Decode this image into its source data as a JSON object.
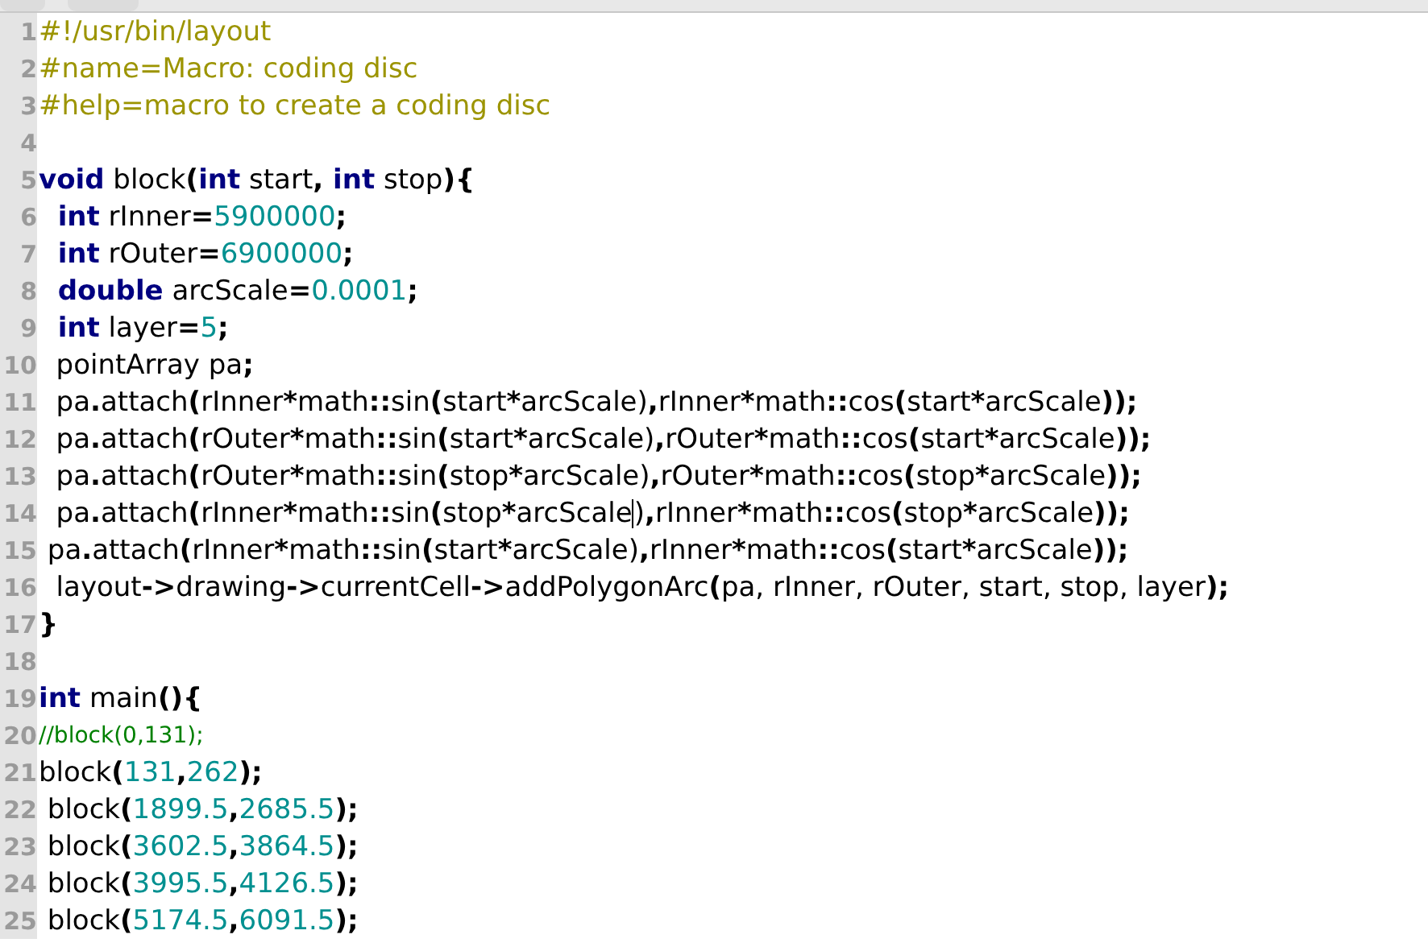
{
  "editor": {
    "lines": [
      {
        "number": "1",
        "tokens": [
          {
            "kind": "meta",
            "text": "#!/usr/bin/layout"
          }
        ]
      },
      {
        "number": "2",
        "tokens": [
          {
            "kind": "meta",
            "text": "#name=Macro: coding disc"
          }
        ]
      },
      {
        "number": "3",
        "tokens": [
          {
            "kind": "meta",
            "text": "#help=macro to create a coding disc"
          }
        ]
      },
      {
        "number": "4"
      },
      {
        "number": "5",
        "tokens": [
          {
            "kind": "kw",
            "text": "void"
          },
          {
            "kind": "id",
            "text": " block"
          },
          {
            "kind": "op",
            "text": "("
          },
          {
            "kind": "kw",
            "text": "int"
          },
          {
            "kind": "id",
            "text": " start"
          },
          {
            "kind": "op",
            "text": ","
          },
          {
            "kind": "kw",
            "text": " int"
          },
          {
            "kind": "id",
            "text": " stop"
          },
          {
            "kind": "op",
            "text": "){"
          }
        ]
      },
      {
        "number": "6",
        "tokens": [
          {
            "kind": "kw",
            "text": "  int"
          },
          {
            "kind": "id",
            "text": " rInner"
          },
          {
            "kind": "op",
            "text": "="
          },
          {
            "kind": "num",
            "text": "5900000"
          },
          {
            "kind": "op",
            "text": ";"
          }
        ]
      },
      {
        "number": "7",
        "tokens": [
          {
            "kind": "kw",
            "text": "  int"
          },
          {
            "kind": "id",
            "text": " rOuter"
          },
          {
            "kind": "op",
            "text": "="
          },
          {
            "kind": "num",
            "text": "6900000"
          },
          {
            "kind": "op",
            "text": ";"
          }
        ]
      },
      {
        "number": "8",
        "tokens": [
          {
            "kind": "kw",
            "text": "  double"
          },
          {
            "kind": "id",
            "text": " arcScale"
          },
          {
            "kind": "op",
            "text": "="
          },
          {
            "kind": "num",
            "text": "0.0001"
          },
          {
            "kind": "op",
            "text": ";"
          }
        ]
      },
      {
        "number": "9",
        "tokens": [
          {
            "kind": "kw",
            "text": "  int"
          },
          {
            "kind": "id",
            "text": " layer"
          },
          {
            "kind": "op",
            "text": "="
          },
          {
            "kind": "num",
            "text": "5"
          },
          {
            "kind": "op",
            "text": ";"
          }
        ]
      },
      {
        "number": "10",
        "tokens": [
          {
            "kind": "id",
            "text": "  pointArray pa"
          },
          {
            "kind": "op",
            "text": ";"
          }
        ]
      },
      {
        "number": "11",
        "tokens": [
          {
            "kind": "id",
            "text": "  pa"
          },
          {
            "kind": "op",
            "text": "."
          },
          {
            "kind": "id",
            "text": "attach"
          },
          {
            "kind": "op",
            "text": "("
          },
          {
            "kind": "id",
            "text": "rInner"
          },
          {
            "kind": "op",
            "text": "*"
          },
          {
            "kind": "id",
            "text": "math"
          },
          {
            "kind": "op",
            "text": "::"
          },
          {
            "kind": "id",
            "text": "sin"
          },
          {
            "kind": "op",
            "text": "("
          },
          {
            "kind": "id",
            "text": "start"
          },
          {
            "kind": "op",
            "text": "*"
          },
          {
            "kind": "id",
            "text": "arcScale)"
          },
          {
            "kind": "op",
            "text": ","
          },
          {
            "kind": "id",
            "text": "rInner"
          },
          {
            "kind": "op",
            "text": "*"
          },
          {
            "kind": "id",
            "text": "math"
          },
          {
            "kind": "op",
            "text": "::"
          },
          {
            "kind": "id",
            "text": "cos"
          },
          {
            "kind": "op",
            "text": "("
          },
          {
            "kind": "id",
            "text": "start"
          },
          {
            "kind": "op",
            "text": "*"
          },
          {
            "kind": "id",
            "text": "arcScale"
          },
          {
            "kind": "op",
            "text": "));"
          }
        ]
      },
      {
        "number": "12",
        "tokens": [
          {
            "kind": "id",
            "text": "  pa"
          },
          {
            "kind": "op",
            "text": "."
          },
          {
            "kind": "id",
            "text": "attach"
          },
          {
            "kind": "op",
            "text": "("
          },
          {
            "kind": "id",
            "text": "rOuter"
          },
          {
            "kind": "op",
            "text": "*"
          },
          {
            "kind": "id",
            "text": "math"
          },
          {
            "kind": "op",
            "text": "::"
          },
          {
            "kind": "id",
            "text": "sin"
          },
          {
            "kind": "op",
            "text": "("
          },
          {
            "kind": "id",
            "text": "start"
          },
          {
            "kind": "op",
            "text": "*"
          },
          {
            "kind": "id",
            "text": "arcScale)"
          },
          {
            "kind": "op",
            "text": ","
          },
          {
            "kind": "id",
            "text": "rOuter"
          },
          {
            "kind": "op",
            "text": "*"
          },
          {
            "kind": "id",
            "text": "math"
          },
          {
            "kind": "op",
            "text": "::"
          },
          {
            "kind": "id",
            "text": "cos"
          },
          {
            "kind": "op",
            "text": "("
          },
          {
            "kind": "id",
            "text": "start"
          },
          {
            "kind": "op",
            "text": "*"
          },
          {
            "kind": "id",
            "text": "arcScale"
          },
          {
            "kind": "op",
            "text": "));"
          }
        ]
      },
      {
        "number": "13",
        "tokens": [
          {
            "kind": "id",
            "text": "  pa"
          },
          {
            "kind": "op",
            "text": "."
          },
          {
            "kind": "id",
            "text": "attach"
          },
          {
            "kind": "op",
            "text": "("
          },
          {
            "kind": "id",
            "text": "rOuter"
          },
          {
            "kind": "op",
            "text": "*"
          },
          {
            "kind": "id",
            "text": "math"
          },
          {
            "kind": "op",
            "text": "::"
          },
          {
            "kind": "id",
            "text": "sin"
          },
          {
            "kind": "op",
            "text": "("
          },
          {
            "kind": "id",
            "text": "stop"
          },
          {
            "kind": "op",
            "text": "*"
          },
          {
            "kind": "id",
            "text": "arcScale)"
          },
          {
            "kind": "op",
            "text": ","
          },
          {
            "kind": "id",
            "text": "rOuter"
          },
          {
            "kind": "op",
            "text": "*"
          },
          {
            "kind": "id",
            "text": "math"
          },
          {
            "kind": "op",
            "text": "::"
          },
          {
            "kind": "id",
            "text": "cos"
          },
          {
            "kind": "op",
            "text": "("
          },
          {
            "kind": "id",
            "text": "stop"
          },
          {
            "kind": "op",
            "text": "*"
          },
          {
            "kind": "id",
            "text": "arcScale"
          },
          {
            "kind": "op",
            "text": "));"
          }
        ]
      },
      {
        "number": "14",
        "tokens": [
          {
            "kind": "id",
            "text": "  pa"
          },
          {
            "kind": "op",
            "text": "."
          },
          {
            "kind": "id",
            "text": "attach"
          },
          {
            "kind": "op",
            "text": "("
          },
          {
            "kind": "id",
            "text": "rInner"
          },
          {
            "kind": "op",
            "text": "*"
          },
          {
            "kind": "id",
            "text": "math"
          },
          {
            "kind": "op",
            "text": "::"
          },
          {
            "kind": "id",
            "text": "sin"
          },
          {
            "kind": "op",
            "text": "("
          },
          {
            "kind": "id",
            "text": "stop"
          },
          {
            "kind": "op",
            "text": "*"
          },
          {
            "kind": "id",
            "text": "arcScale"
          },
          {
            "kind": "cursor"
          },
          {
            "kind": "id",
            "text": ")"
          },
          {
            "kind": "op",
            "text": ","
          },
          {
            "kind": "id",
            "text": "rInner"
          },
          {
            "kind": "op",
            "text": "*"
          },
          {
            "kind": "id",
            "text": "math"
          },
          {
            "kind": "op",
            "text": "::"
          },
          {
            "kind": "id",
            "text": "cos"
          },
          {
            "kind": "op",
            "text": "("
          },
          {
            "kind": "id",
            "text": "stop"
          },
          {
            "kind": "op",
            "text": "*"
          },
          {
            "kind": "id",
            "text": "arcScale"
          },
          {
            "kind": "op",
            "text": "));"
          }
        ]
      },
      {
        "number": "15",
        "tokens": [
          {
            "kind": "id",
            "text": " pa"
          },
          {
            "kind": "op",
            "text": "."
          },
          {
            "kind": "id",
            "text": "attach"
          },
          {
            "kind": "op",
            "text": "("
          },
          {
            "kind": "id",
            "text": "rInner"
          },
          {
            "kind": "op",
            "text": "*"
          },
          {
            "kind": "id",
            "text": "math"
          },
          {
            "kind": "op",
            "text": "::"
          },
          {
            "kind": "id",
            "text": "sin"
          },
          {
            "kind": "op",
            "text": "("
          },
          {
            "kind": "id",
            "text": "start"
          },
          {
            "kind": "op",
            "text": "*"
          },
          {
            "kind": "id",
            "text": "arcScale)"
          },
          {
            "kind": "op",
            "text": ","
          },
          {
            "kind": "id",
            "text": "rInner"
          },
          {
            "kind": "op",
            "text": "*"
          },
          {
            "kind": "id",
            "text": "math"
          },
          {
            "kind": "op",
            "text": "::"
          },
          {
            "kind": "id",
            "text": "cos"
          },
          {
            "kind": "op",
            "text": "("
          },
          {
            "kind": "id",
            "text": "start"
          },
          {
            "kind": "op",
            "text": "*"
          },
          {
            "kind": "id",
            "text": "arcScale"
          },
          {
            "kind": "op",
            "text": "));"
          }
        ]
      },
      {
        "number": "16",
        "tokens": [
          {
            "kind": "id",
            "text": "  layout"
          },
          {
            "kind": "op",
            "text": "->"
          },
          {
            "kind": "id",
            "text": "drawing"
          },
          {
            "kind": "op",
            "text": "->"
          },
          {
            "kind": "id",
            "text": "currentCell"
          },
          {
            "kind": "op",
            "text": "->"
          },
          {
            "kind": "id",
            "text": "addPolygonArc"
          },
          {
            "kind": "op",
            "text": "("
          },
          {
            "kind": "id",
            "text": "pa, rInner, rOuter, start, stop, layer"
          },
          {
            "kind": "op",
            "text": ");"
          }
        ]
      },
      {
        "number": "17",
        "tokens": [
          {
            "kind": "op",
            "text": "}"
          }
        ]
      },
      {
        "number": "18"
      },
      {
        "number": "19",
        "tokens": [
          {
            "kind": "kw",
            "text": "int"
          },
          {
            "kind": "id",
            "text": " main"
          },
          {
            "kind": "op",
            "text": "(){"
          }
        ]
      },
      {
        "number": "20",
        "tokens": [
          {
            "kind": "comment",
            "text": "//block(0,131);"
          }
        ]
      },
      {
        "number": "21",
        "tokens": [
          {
            "kind": "id",
            "text": "block"
          },
          {
            "kind": "op",
            "text": "("
          },
          {
            "kind": "num",
            "text": "131"
          },
          {
            "kind": "op",
            "text": ","
          },
          {
            "kind": "num",
            "text": "262"
          },
          {
            "kind": "op",
            "text": ");"
          }
        ]
      },
      {
        "number": "22",
        "tokens": [
          {
            "kind": "id",
            "text": " block"
          },
          {
            "kind": "op",
            "text": "("
          },
          {
            "kind": "num",
            "text": "1899.5"
          },
          {
            "kind": "op",
            "text": ","
          },
          {
            "kind": "num",
            "text": "2685.5"
          },
          {
            "kind": "op",
            "text": ");"
          }
        ]
      },
      {
        "number": "23",
        "tokens": [
          {
            "kind": "id",
            "text": " block"
          },
          {
            "kind": "op",
            "text": "("
          },
          {
            "kind": "num",
            "text": "3602.5"
          },
          {
            "kind": "op",
            "text": ","
          },
          {
            "kind": "num",
            "text": "3864.5"
          },
          {
            "kind": "op",
            "text": ");"
          }
        ]
      },
      {
        "number": "24",
        "tokens": [
          {
            "kind": "id",
            "text": " block"
          },
          {
            "kind": "op",
            "text": "("
          },
          {
            "kind": "num",
            "text": "3995.5"
          },
          {
            "kind": "op",
            "text": ","
          },
          {
            "kind": "num",
            "text": "4126.5"
          },
          {
            "kind": "op",
            "text": ");"
          }
        ]
      },
      {
        "number": "25",
        "tokens": [
          {
            "kind": "id",
            "text": " block"
          },
          {
            "kind": "op",
            "text": "("
          },
          {
            "kind": "num",
            "text": "5174.5"
          },
          {
            "kind": "op",
            "text": ","
          },
          {
            "kind": "num",
            "text": "6091.5"
          },
          {
            "kind": "op",
            "text": ");"
          }
        ]
      }
    ]
  }
}
